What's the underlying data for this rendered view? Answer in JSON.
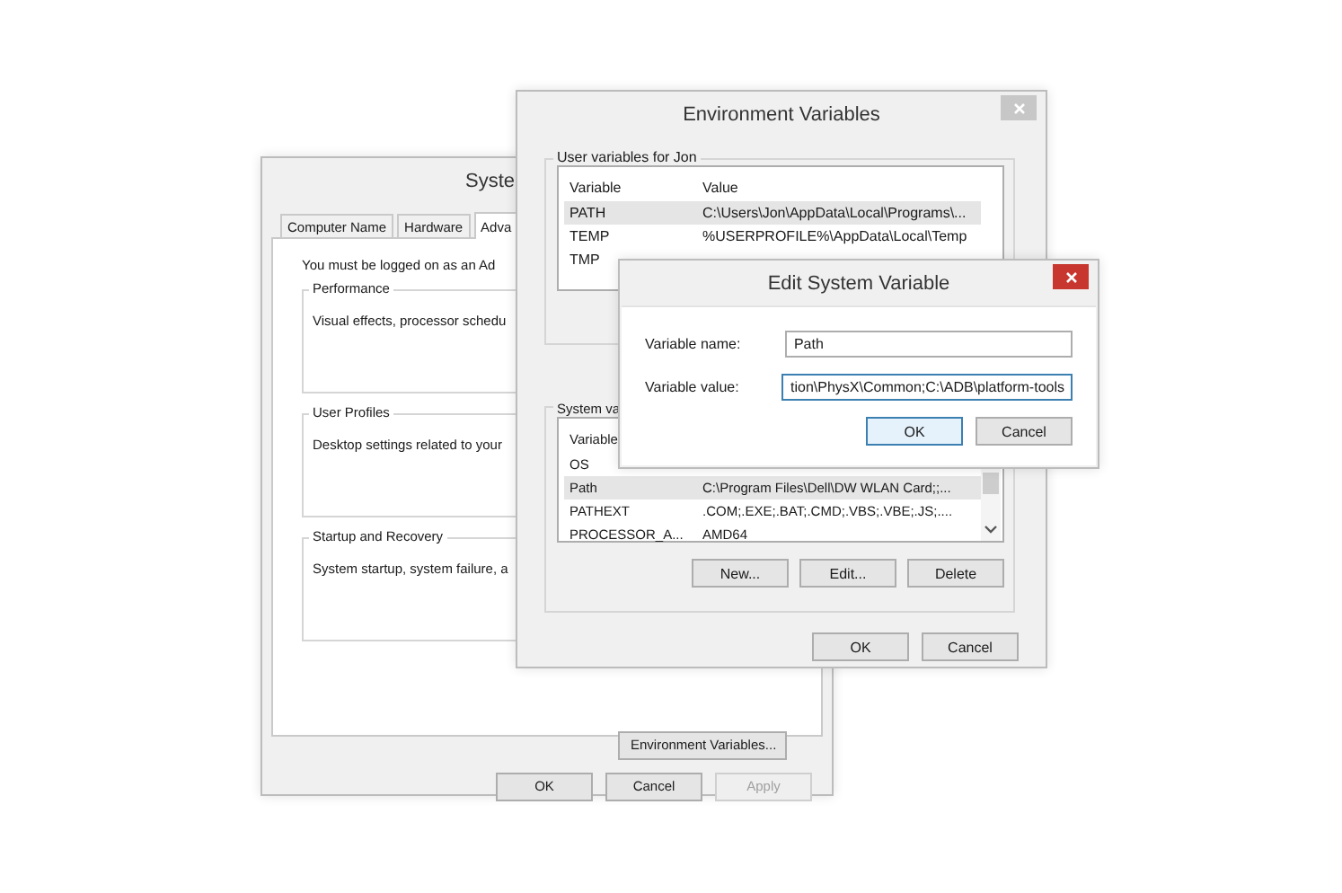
{
  "system_properties": {
    "title": "Syste",
    "tabs": [
      {
        "label": "Computer Name",
        "selected": false
      },
      {
        "label": "Hardware",
        "selected": false
      },
      {
        "label": "Adva",
        "selected": true
      }
    ],
    "notice": "You must be logged on as an Ad",
    "groups": [
      {
        "title": "Performance",
        "text": "Visual effects, processor schedu"
      },
      {
        "title": "User Profiles",
        "text": "Desktop settings related to your"
      },
      {
        "title": "Startup and Recovery",
        "text": "System startup, system failure, a"
      }
    ],
    "env_button": "Environment Variables...",
    "buttons": [
      {
        "label": "OK",
        "disabled": false
      },
      {
        "label": "Cancel",
        "disabled": false
      },
      {
        "label": "Apply",
        "disabled": true
      }
    ]
  },
  "environment_variables": {
    "title": "Environment Variables",
    "user_group": {
      "title": "User variables for Jon",
      "columns": [
        "Variable",
        "Value"
      ],
      "rows": [
        {
          "variable": "PATH",
          "value": "C:\\Users\\Jon\\AppData\\Local\\Programs\\...",
          "selected": true
        },
        {
          "variable": "TEMP",
          "value": "%USERPROFILE%\\AppData\\Local\\Temp",
          "selected": false
        },
        {
          "variable": "TMP",
          "selected": false
        }
      ]
    },
    "system_group": {
      "title": "System va",
      "columns": [
        "Variable"
      ],
      "rows": [
        {
          "variable": "OS",
          "selected": false
        },
        {
          "variable": "Path",
          "value": "C:\\Program Files\\Dell\\DW WLAN Card;;...",
          "selected": true
        },
        {
          "variable": "PATHEXT",
          "value": ".COM;.EXE;.BAT;.CMD;.VBS;.VBE;.JS;....",
          "selected": false
        },
        {
          "variable": "PROCESSOR_A...",
          "value": "AMD64",
          "selected": false
        }
      ]
    },
    "system_buttons": [
      "New...",
      "Edit...",
      "Delete"
    ],
    "buttons": [
      "OK",
      "Cancel"
    ]
  },
  "edit_system_variable": {
    "title": "Edit System Variable",
    "fields": [
      {
        "label": "Variable name:",
        "value": "Path"
      },
      {
        "label": "Variable value:",
        "value": "tion\\PhysX\\Common;C:\\ADB\\platform-tools"
      }
    ],
    "buttons": [
      {
        "label": "OK",
        "default": true
      },
      {
        "label": "Cancel",
        "default": false
      }
    ]
  }
}
